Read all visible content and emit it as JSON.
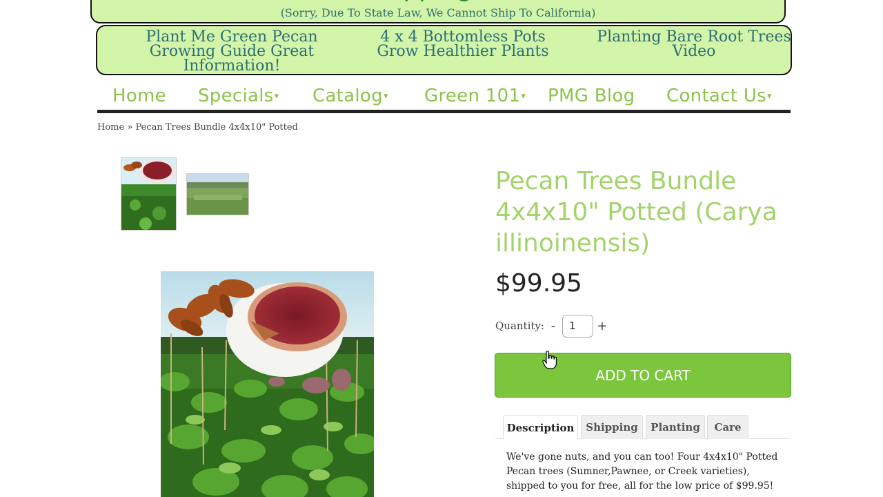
{
  "top_banner": {
    "heading_fragment": "pping",
    "notice": "(Sorry, Due To State Law, We Cannot Ship To California)"
  },
  "promos": [
    {
      "text": "Plant Me Green Pecan Growing Guide Great Information!"
    },
    {
      "text": "4 x 4 Bottomless Pots Grow Healthier Plants"
    },
    {
      "text": "Planting Bare Root Trees Video"
    }
  ],
  "nav": {
    "home": "Home",
    "specials": "Specials",
    "catalog": "Catalog",
    "green101": "Green 101",
    "blog": "PMG Blog",
    "contact": "Contact Us"
  },
  "breadcrumb": {
    "home": "Home",
    "separator": "»",
    "current": "Pecan Trees Bundle 4x4x10\" Potted"
  },
  "product": {
    "title": "Pecan Trees Bundle 4x4x10\" Potted (Carya illinoinensis)",
    "price": "$99.95",
    "quantity_label": "Quantity:",
    "quantity_value": "1",
    "minus": "-",
    "plus": "+",
    "add_to_cart": "ADD TO CART"
  },
  "tabs": [
    {
      "label": "Description",
      "active": true
    },
    {
      "label": "Shipping"
    },
    {
      "label": "Planting"
    },
    {
      "label": "Care"
    }
  ],
  "description": "We've gone nuts, and you can too! Four 4x4x10\" Potted Pecan trees (Sumner,Pawnee, or Creek varieties), shipped to you for free, all for the low price of $99.95!",
  "colors": {
    "banner_bg": "#d3f5a9",
    "nav_green": "#8cc44a",
    "title_green": "#a3d36b",
    "cart_green": "#7cc63d"
  }
}
